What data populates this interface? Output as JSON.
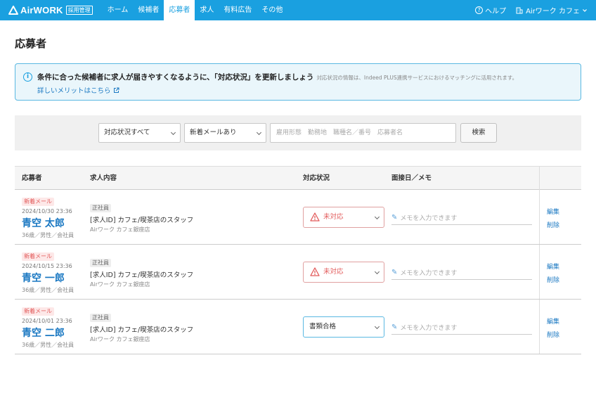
{
  "header": {
    "logo_text": "AirWORK",
    "logo_badge": "採用管理",
    "nav": [
      "ホーム",
      "候補者",
      "応募者",
      "求人",
      "有料広告",
      "その他"
    ],
    "active_nav": "応募者",
    "help_label": "ヘルプ",
    "account_label": "Airワーク カフェ"
  },
  "page_title": "応募者",
  "banner": {
    "main": "条件に合った候補者に求人が届きやすくなるように、「対応状況」を更新しましょう",
    "sub": "対応状況の情報は、Indeed PLUS連携サービスにおけるマッチングに活用されます。",
    "link": "詳しいメリットはこちら"
  },
  "filter": {
    "status_select": "対応状況すべて",
    "mail_select": "新着メールあり",
    "search_placeholder": "雇用形態　勤務地　職種名／番号　応募者名",
    "search_button": "検索"
  },
  "table": {
    "headers": {
      "applicant": "応募者",
      "job": "求人内容",
      "status": "対応状況",
      "memo": "面接日／メモ"
    },
    "rows": [
      {
        "tag": "新着メール",
        "date": "2024/10/30 23:36",
        "name": "青空 太郎",
        "profile": "36歳／男性／会社員",
        "employment": "正社員",
        "job_title": "[求人ID] カフェ/喫茶店のスタッフ",
        "store": "Airワーク カフェ銀座店",
        "status": "未対応",
        "memo_placeholder": "メモを入力できます",
        "edit": "編集",
        "delete": "削除"
      },
      {
        "tag": "新着メール",
        "date": "2024/10/15 23:36",
        "name": "青空 一郎",
        "profile": "36歳／男性／会社員",
        "employment": "正社員",
        "job_title": "[求人ID] カフェ/喫茶店のスタッフ",
        "store": "Airワーク カフェ銀座店",
        "status": "未対応",
        "memo_placeholder": "メモを入力できます",
        "edit": "編集",
        "delete": "削除"
      },
      {
        "tag": "新着メール",
        "date": "2024/10/01 23:36",
        "name": "青空 二郎",
        "profile": "36歳／男性／会社員",
        "employment": "正社員",
        "job_title": "[求人ID] カフェ/喫茶店のスタッフ",
        "store": "Airワーク カフェ銀座店",
        "status": "書類合格",
        "memo_placeholder": "メモを入力できます",
        "edit": "編集",
        "delete": "削除"
      }
    ]
  },
  "colors": {
    "brand": "#1aa0e0",
    "link": "#1a78c2",
    "alert": "#e25a5a"
  }
}
